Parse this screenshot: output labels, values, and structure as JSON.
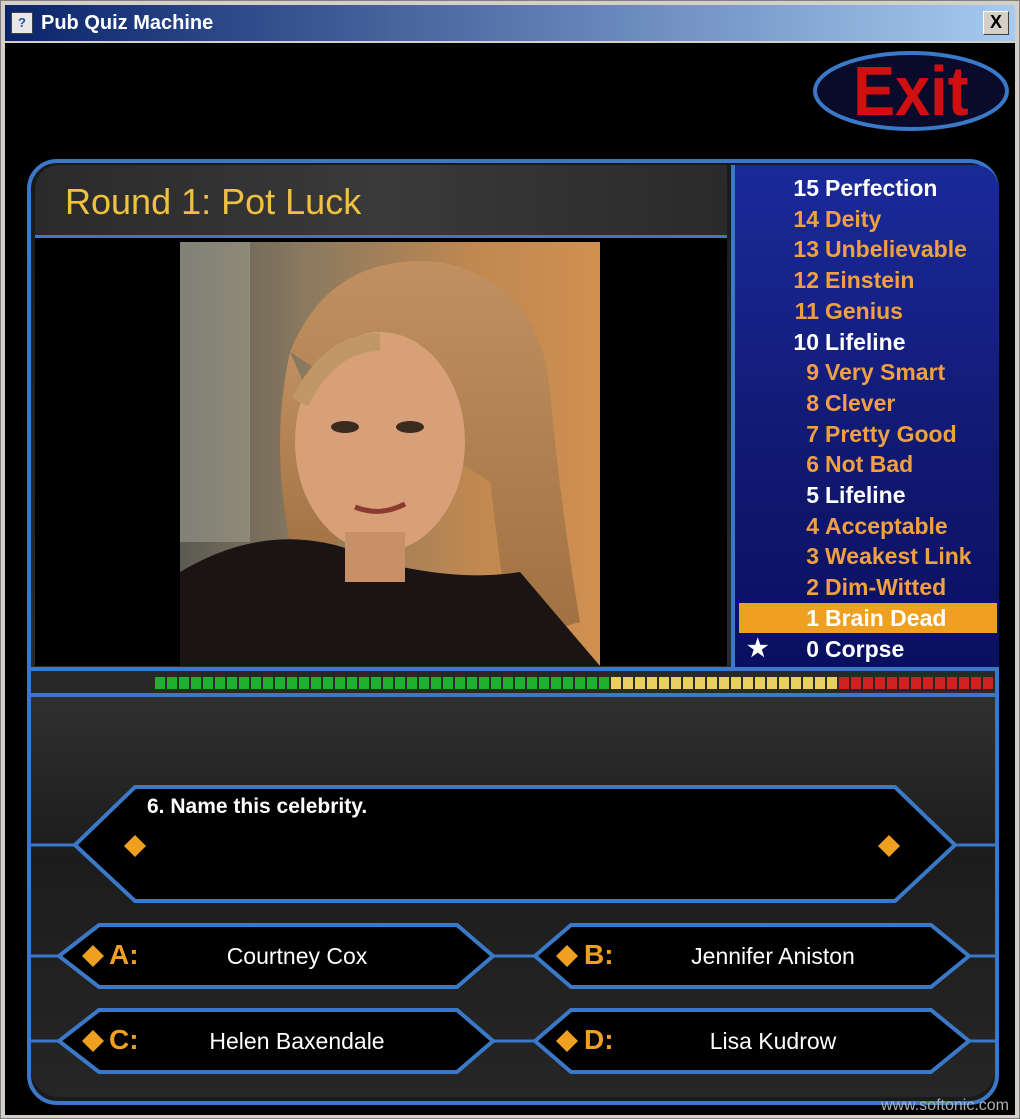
{
  "window": {
    "title": "Pub Quiz Machine",
    "close_label": "X"
  },
  "exit_label": "Exit",
  "round_title": "Round 1: Pot Luck",
  "ladder": [
    {
      "num": "15",
      "label": "Perfection",
      "color": "#ffffff",
      "highlight": false
    },
    {
      "num": "14",
      "label": "Deity",
      "color": "#f0a040",
      "highlight": false
    },
    {
      "num": "13",
      "label": "Unbelievable",
      "color": "#f0a040",
      "highlight": false
    },
    {
      "num": "12",
      "label": "Einstein",
      "color": "#f0a040",
      "highlight": false
    },
    {
      "num": "11",
      "label": "Genius",
      "color": "#f0a040",
      "highlight": false
    },
    {
      "num": "10",
      "label": "Lifeline",
      "color": "#ffffff",
      "highlight": false
    },
    {
      "num": "9",
      "label": "Very Smart",
      "color": "#f0a040",
      "highlight": false
    },
    {
      "num": "8",
      "label": "Clever",
      "color": "#f0a040",
      "highlight": false
    },
    {
      "num": "7",
      "label": "Pretty Good",
      "color": "#f0a040",
      "highlight": false
    },
    {
      "num": "6",
      "label": "Not Bad",
      "color": "#f0a040",
      "highlight": false
    },
    {
      "num": "5",
      "label": "Lifeline",
      "color": "#ffffff",
      "highlight": false
    },
    {
      "num": "4",
      "label": "Acceptable",
      "color": "#f0a040",
      "highlight": false
    },
    {
      "num": "3",
      "label": "Weakest Link",
      "color": "#f0a040",
      "highlight": false
    },
    {
      "num": "2",
      "label": "Dim-Witted",
      "color": "#f0a040",
      "highlight": false
    },
    {
      "num": "1",
      "label": "Brain Dead",
      "color": "#ffffff",
      "highlight": true
    },
    {
      "num": "0",
      "label": "Corpse",
      "color": "#ffffff",
      "highlight": false,
      "star": "★"
    }
  ],
  "timer": {
    "green": 38,
    "yellow": 19,
    "red": 13,
    "fraction_remaining": 1.0
  },
  "question": "6. Name this celebrity.",
  "answers": [
    {
      "letter": "A:",
      "text": "Courtney Cox"
    },
    {
      "letter": "B:",
      "text": "Jennifer Aniston"
    },
    {
      "letter": "C:",
      "text": "Helen Baxendale"
    },
    {
      "letter": "D:",
      "text": "Lisa Kudrow"
    }
  ],
  "colors": {
    "frame_blue": "#3a78c8",
    "accent_orange": "#f0a020",
    "title_yellow": "#f0c040",
    "exit_red": "#d01010"
  },
  "watermark": "www.softonic.com"
}
